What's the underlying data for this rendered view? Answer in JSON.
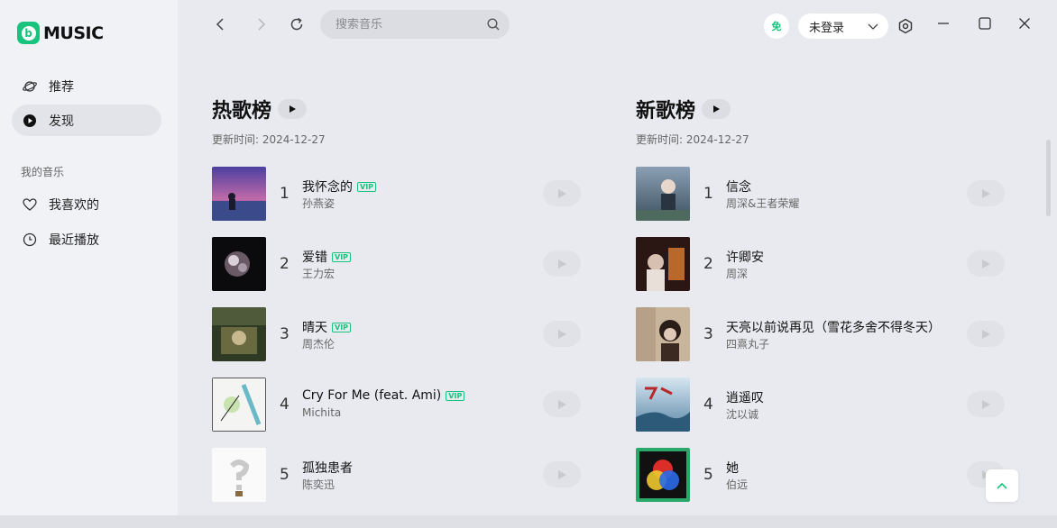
{
  "app": {
    "logo_letter": "b",
    "logo_text": "MUSIC",
    "accent": "#19c37d"
  },
  "sidebar": {
    "items": [
      {
        "label": "推荐",
        "icon": "planet-icon"
      },
      {
        "label": "发现",
        "icon": "disc-icon",
        "active": true
      }
    ],
    "section_title": "我的音乐",
    "my_items": [
      {
        "label": "我喜欢的",
        "icon": "heart-icon"
      },
      {
        "label": "最近播放",
        "icon": "clock-icon"
      }
    ]
  },
  "topbar": {
    "search_placeholder": "搜索音乐",
    "vip_badge": "免",
    "login_label": "未登录"
  },
  "charts": [
    {
      "title": "热歌榜",
      "date": "更新时间: 2024-12-27",
      "songs": [
        {
          "rank": "1",
          "name": "我怀念的",
          "artist": "孙燕姿",
          "vip": "VIP"
        },
        {
          "rank": "2",
          "name": "爱错",
          "artist": "王力宏",
          "vip": "VIP"
        },
        {
          "rank": "3",
          "name": "晴天",
          "artist": "周杰伦",
          "vip": "VIP"
        },
        {
          "rank": "4",
          "name": "Cry For Me (feat. Ami)",
          "artist": "Michita",
          "vip": "VIP"
        },
        {
          "rank": "5",
          "name": "孤独患者",
          "artist": "陈奕迅",
          "vip": ""
        }
      ]
    },
    {
      "title": "新歌榜",
      "date": "更新时间: 2024-12-27",
      "songs": [
        {
          "rank": "1",
          "name": "信念",
          "artist": "周深&王者荣耀",
          "vip": ""
        },
        {
          "rank": "2",
          "name": "许卿安",
          "artist": "周深",
          "vip": ""
        },
        {
          "rank": "3",
          "name": "天亮以前说再见（雪花多舍不得冬天）",
          "artist": "四熹丸子",
          "vip": ""
        },
        {
          "rank": "4",
          "name": "逍遥叹",
          "artist": "沈以诚",
          "vip": ""
        },
        {
          "rank": "5",
          "name": "她",
          "artist": "伯远",
          "vip": ""
        }
      ]
    }
  ]
}
